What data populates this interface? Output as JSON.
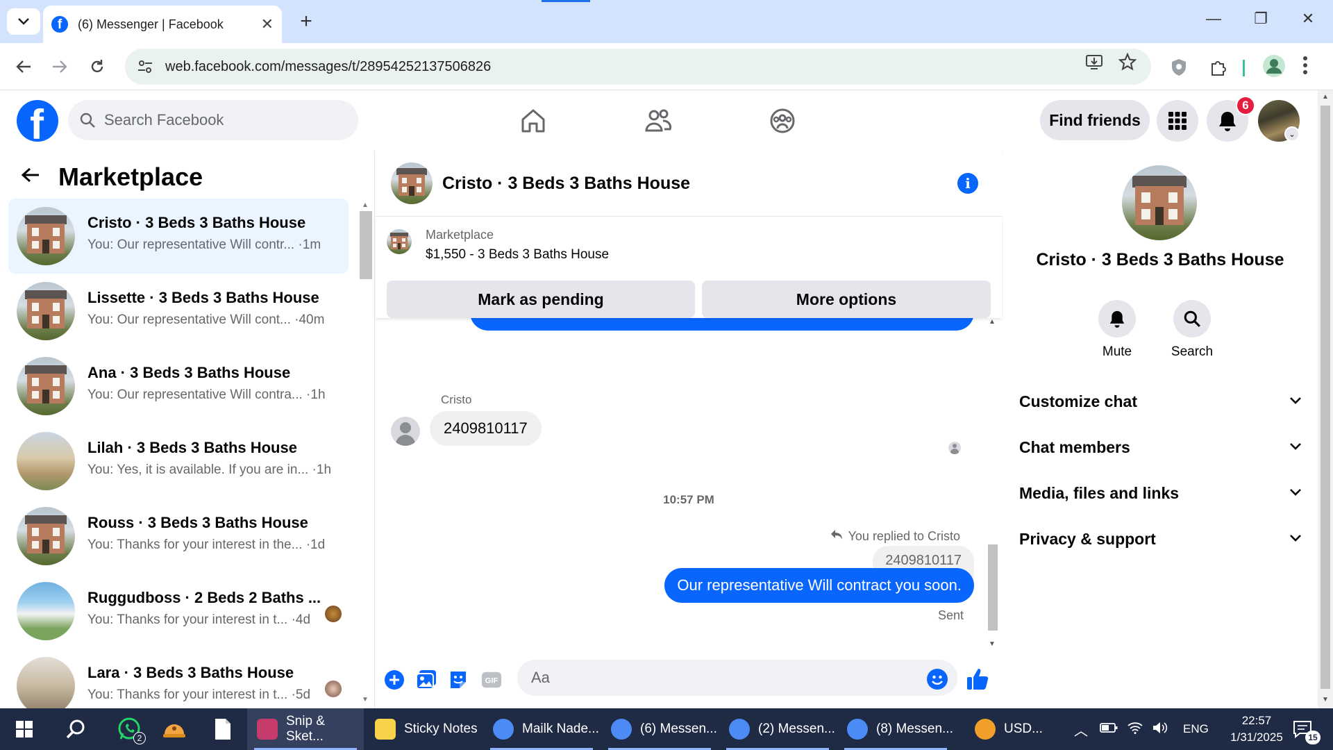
{
  "browser": {
    "tab_title": "(6) Messenger | Facebook",
    "url": "web.facebook.com/messages/t/28954252137506826"
  },
  "fb_header": {
    "search_placeholder": "Search Facebook",
    "find_friends": "Find friends",
    "notification_count": "6"
  },
  "left_panel": {
    "title": "Marketplace",
    "conversations": [
      {
        "name": "Cristo · 3 Beds 3 Baths House",
        "preview": "You: Our representative Will contr... ·1m",
        "active": true
      },
      {
        "name": "Lissette · 3 Beds 3 Baths House",
        "preview": "You: Our representative Will cont... ·40m",
        "active": false
      },
      {
        "name": "Ana · 3 Beds 3 Baths House",
        "preview": "You: Our representative Will contra... ·1h",
        "active": false
      },
      {
        "name": "Lilah · 3 Beds 3 Baths House",
        "preview": "You: Yes, it is available. If you are in... ·1h",
        "active": false
      },
      {
        "name": "Rouss · 3 Beds 3 Baths House",
        "preview": "You: Thanks for your interest in the... ·1d",
        "active": false
      },
      {
        "name": "Ruggudboss · 2 Beds 2 Baths ...",
        "preview": "You: Thanks for your interest in t... ·4d",
        "active": false
      },
      {
        "name": "Lara · 3 Beds 3 Baths House",
        "preview": "You: Thanks for your interest in t... ·5d",
        "active": false
      }
    ]
  },
  "chat": {
    "title": "Cristo · 3 Beds 3 Baths House",
    "marketplace_label": "Marketplace",
    "listing": "$1,550 - 3 Beds 3 Baths House",
    "mark_pending": "Mark as pending",
    "more_options": "More options",
    "sender_name": "Cristo",
    "received_message": "2409810117",
    "timestamp": "10:57 PM",
    "replied_label": "You replied to Cristo",
    "quoted_message": "2409810117",
    "sent_message": "Our representative Will contract you soon.",
    "sent_status": "Sent",
    "composer_placeholder": "Aa"
  },
  "right_panel": {
    "title": "Cristo · 3 Beds 3 Baths House",
    "actions": [
      {
        "label": "Mute",
        "icon": "bell-icon"
      },
      {
        "label": "Search",
        "icon": "search-icon"
      }
    ],
    "sections": [
      "Customize chat",
      "Chat members",
      "Media, files and links",
      "Privacy & support"
    ]
  },
  "taskbar": {
    "items": [
      {
        "label": "Snip & Sket...",
        "color": "#c53b6b"
      },
      {
        "label": "Sticky Notes",
        "color": "#f7d34a"
      },
      {
        "label": "Mailk Nade...",
        "color": "#4c8bf5"
      },
      {
        "label": "(6) Messen...",
        "color": "#4c8bf5"
      },
      {
        "label": "(2) Messen...",
        "color": "#4c8bf5"
      },
      {
        "label": "(8) Messen...",
        "color": "#4c8bf5"
      },
      {
        "label": "USD...",
        "color": "#f0a02a"
      }
    ],
    "whatsapp_badge": "2",
    "language": "ENG",
    "time": "22:57",
    "date": "1/31/2025",
    "notifications": "15"
  },
  "colors": {
    "fb_blue": "#0866ff",
    "badge_red": "#e41e3f",
    "chrome_tab_strip": "#d3e3fd"
  }
}
